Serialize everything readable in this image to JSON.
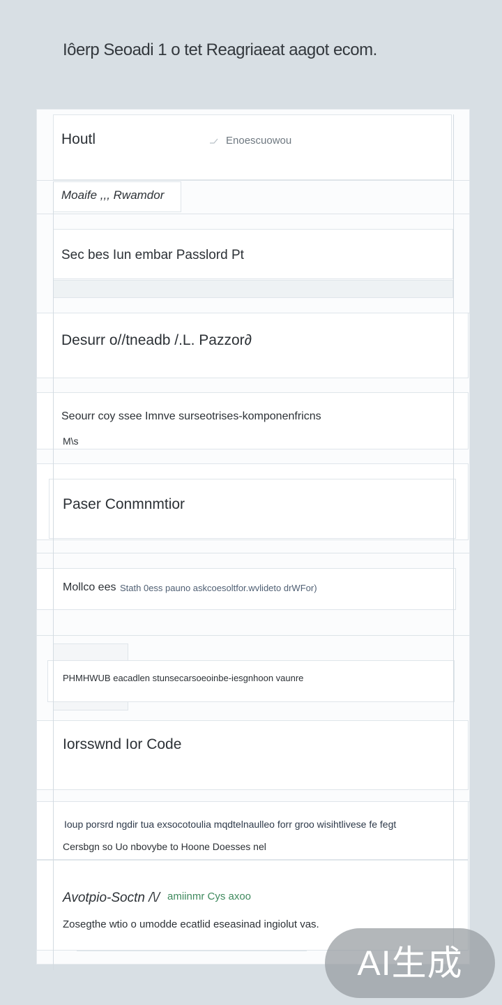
{
  "page": {
    "title": "Iôerp Seoadi 1 o tet  Reagriaeat aagot ecom."
  },
  "form": {
    "row1": {
      "label": "Houtl",
      "hint": "Enoescuowou"
    },
    "row2": {
      "label": "Moaife ,,, Rwamdor"
    },
    "row3": {
      "label": "Sec bes Iun embar Passlord Pt"
    },
    "row4": {
      "label": "Desurr o//tneadb /.L. Pazzor∂"
    },
    "row5": {
      "label": "Seourr coy ssee Imnve surseotrises-komponenfricns",
      "sub": "M\\s"
    },
    "row6": {
      "label": "Paser Conmnmtior"
    },
    "row7": {
      "label": "Mollco ees",
      "detail": "Stath 0ess pauno askcoesoltfor.wvlideto drWFor)"
    },
    "row8": {
      "label": "PHMHWUB eacadlen stunsecarsoeoinbe-iesgnhoon vaunre"
    },
    "row9": {
      "label": "Iorsswnd  Ior  Code"
    },
    "row10": {
      "line1": "Ioup porsrd ngdir  tua exsocotoulia mqdtelnaulleo forr  groo wisihtlivese fe fegt",
      "line2": "Cersbgn so Uo nbovybe to Hoone Doesses nel"
    },
    "row11": {
      "label": "Avotpio-Soctn /\\/",
      "accent": "amiinmr Cys axoo",
      "desc": "Zosegthe wtio  o umodde ecatlid eseasinad ingiolut vas."
    }
  },
  "watermark": {
    "text": "AI生成"
  },
  "icons": {
    "row1_indicator": "arrow-right-icon"
  },
  "colors": {
    "background": "#d8dfe4",
    "accent_green": "#3f8a5e"
  }
}
